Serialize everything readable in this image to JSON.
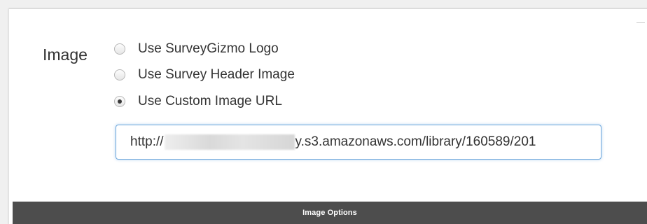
{
  "image_setting": {
    "label": "Image",
    "options": [
      {
        "label": "Use SurveyGizmo Logo",
        "checked": false
      },
      {
        "label": "Use Survey Header Image",
        "checked": false
      },
      {
        "label": "Use Custom Image URL",
        "checked": true
      }
    ],
    "custom_url": {
      "prefix": "http://",
      "suffix": "y.s3.amazonaws.com/library/160589/201"
    }
  },
  "footer": {
    "title": "Image Options",
    "background_color": "#4d4d4d"
  },
  "colors": {
    "focus_border": "#6fa8dc",
    "text": "#333333"
  }
}
